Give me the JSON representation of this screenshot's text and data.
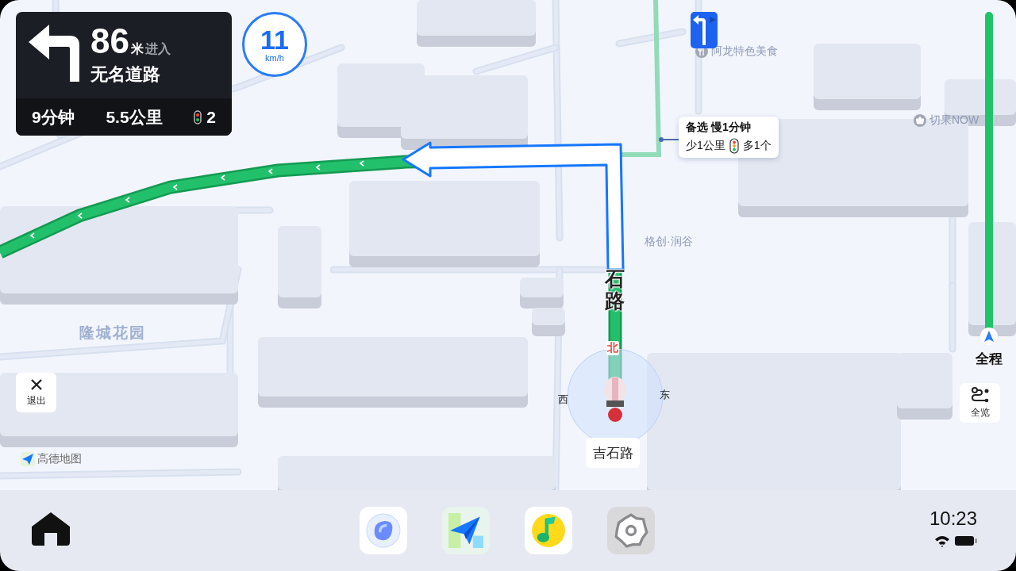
{
  "guidance": {
    "distance": "86",
    "distance_unit": "米",
    "action": "进入",
    "road": "无名道路",
    "time": "9分钟",
    "remaining": "5.5公里",
    "lights": "2"
  },
  "speed": {
    "value": "11",
    "unit": "km/h"
  },
  "alternative_route": {
    "title": "备选 慢1分钟",
    "distance_diff": "少1公里",
    "lights_diff": "多1个"
  },
  "map_labels": [
    {
      "text": "阿龙特色美食",
      "kind": "food"
    },
    {
      "text": "切果NOW",
      "kind": "shop"
    },
    {
      "text": "格创·润谷",
      "kind": "area"
    },
    {
      "text": "隆城花园",
      "kind": "district"
    }
  ],
  "road_label": "石路",
  "compass": {
    "north": "北",
    "west": "西",
    "east": "东"
  },
  "current_road": "吉石路",
  "exit_button": "退出",
  "progress": {
    "label": "全程",
    "level": 1
  },
  "overview_button": "全览",
  "brand": "高德地图",
  "dock": {
    "apps": [
      {
        "kind": "assistant"
      },
      {
        "kind": "navigation"
      },
      {
        "kind": "music"
      },
      {
        "kind": "settings"
      }
    ],
    "time": "10:23"
  }
}
